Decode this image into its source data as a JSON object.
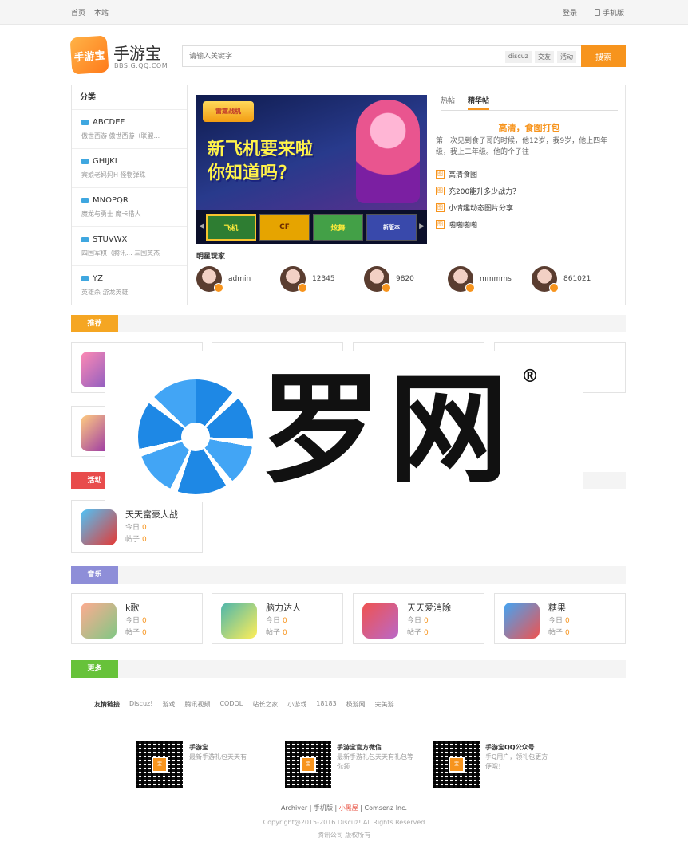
{
  "topbar": {
    "home": "首页",
    "site": "本站",
    "login": "登录",
    "mobile": "手机版"
  },
  "header": {
    "logo_text": "手游宝",
    "brand": "手游宝",
    "brand_sub": "BBS.G.QQ.COM"
  },
  "search": {
    "placeholder": "请输入关键字",
    "tags": [
      "discuz",
      "交友",
      "活动"
    ],
    "button": "搜索"
  },
  "categories": {
    "title": "分类",
    "items": [
      {
        "name": "ABCDEF",
        "sub": "傲世西游  傲世西游（联盟..."
      },
      {
        "name": "GHIJKL",
        "sub": "宾娘老妈妈H  怪物弹珠"
      },
      {
        "name": "MNOPQR",
        "sub": "魔龙与勇士  魔卡猎人"
      },
      {
        "name": "STUVWX",
        "sub": "四国军棋（腾讯...  三国英杰"
      },
      {
        "name": "YZ",
        "sub": "英雄杀  游龙英雄"
      }
    ]
  },
  "banner": {
    "logo": "雷霆战机",
    "line1": "新飞机要来啦",
    "line2": "你知道吗？",
    "thumbs": [
      "飞机",
      "CF",
      "炫舞",
      "新版本"
    ]
  },
  "hot": {
    "tabs": [
      "热帖",
      "精华帖"
    ],
    "title": "高清，食图打包",
    "desc": "第一次见到食子哥的时候，他12岁，我9岁，他上四年级，我上二年级。他的个子往",
    "items": [
      "高清食图",
      "充200能升多少战力？",
      "小情趣动态图片分享",
      "啪啪啪啪"
    ]
  },
  "stars": {
    "title": "明星玩家",
    "users": [
      "admin",
      "12345",
      "9820",
      "mmmms",
      "861021"
    ]
  },
  "sections": {
    "recommend": "推荐",
    "activity": "活动",
    "music": "音乐",
    "more": "更多"
  },
  "activity_cards": [
    {
      "title": "天天富豪大战",
      "today_label": "今日",
      "today": "0",
      "posts_label": "帖子",
      "posts": "0"
    }
  ],
  "music_cards": [
    {
      "title": "k歌",
      "today_label": "今日",
      "today": "0",
      "posts_label": "帖子",
      "posts": "0"
    },
    {
      "title": "脑力达人",
      "today_label": "今日",
      "today": "0",
      "posts_label": "帖子",
      "posts": "0"
    },
    {
      "title": "天天爱消除",
      "today_label": "今日",
      "today": "0",
      "posts_label": "帖子",
      "posts": "0"
    },
    {
      "title": "糖果",
      "today_label": "今日",
      "today": "0",
      "posts_label": "帖子",
      "posts": "0"
    }
  ],
  "links": {
    "title": "友情链接",
    "items": [
      "Discuz!",
      "游戏",
      "腾讯视频",
      "CODOL",
      "站长之家",
      "小游戏",
      "18183",
      "极游网",
      "完美游"
    ]
  },
  "qrcodes": [
    {
      "title": "手游宝",
      "desc": "最新手游礼包天天有"
    },
    {
      "title": "手游宝官方微信",
      "desc": "最新手游礼包天天有礼包等你领"
    },
    {
      "title": "手游宝QQ公众号",
      "desc": "手Q用户，领礼包更方便哦！"
    }
  ],
  "footer": {
    "archiver": "Archiver",
    "mobile": "手机版",
    "blackroom": "小黑屋",
    "company": "Comsenz Inc.",
    "copyright": "Copyright@2015-2016 Discuz! All Rights Reserved",
    "owner": "腾讯公司 版权所有"
  },
  "watermark": {
    "text": "罗网",
    "reg": "®"
  },
  "colors": {
    "accent": "#f7941d",
    "recommend": "#f5a623",
    "activity": "#e84c4c",
    "music": "#8e8ed8",
    "more": "#67c23a"
  }
}
